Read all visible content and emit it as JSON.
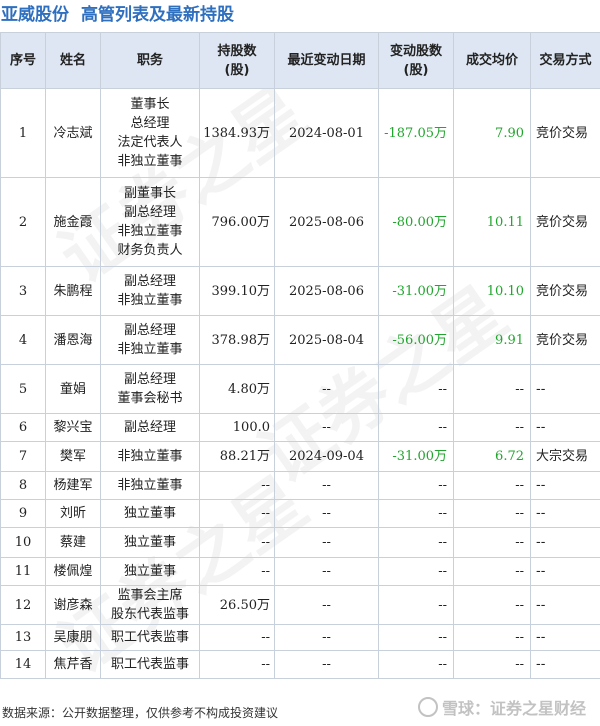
{
  "header": {
    "company": "亚威股份",
    "title": "高管列表及最新持股"
  },
  "table": {
    "columns": [
      "序号",
      "姓名",
      "职务",
      "持股数\n(股)",
      "最近变动日期",
      "变动股数\n(股)",
      "成交均价",
      "交易方式"
    ],
    "rows": [
      {
        "no": "1",
        "name": "冷志斌",
        "roles": [
          "董事长",
          "总经理",
          "法定代表人",
          "非独立董事"
        ],
        "holding": "1384.93万",
        "date": "2024-08-01",
        "change": "-187.05万",
        "price": "7.90",
        "method": "竞价交易"
      },
      {
        "no": "2",
        "name": "施金霞",
        "roles": [
          "副董事长",
          "副总经理",
          "非独立董事",
          "财务负责人"
        ],
        "holding": "796.00万",
        "date": "2025-08-06",
        "change": "-80.00万",
        "price": "10.11",
        "method": "竞价交易"
      },
      {
        "no": "3",
        "name": "朱鹏程",
        "roles": [
          "副总经理",
          "非独立董事"
        ],
        "holding": "399.10万",
        "date": "2025-08-06",
        "change": "-31.00万",
        "price": "10.10",
        "method": "竞价交易"
      },
      {
        "no": "4",
        "name": "潘恩海",
        "roles": [
          "副总经理",
          "非独立董事"
        ],
        "holding": "378.98万",
        "date": "2025-08-04",
        "change": "-56.00万",
        "price": "9.91",
        "method": "竞价交易"
      },
      {
        "no": "5",
        "name": "童娟",
        "roles": [
          "副总经理",
          "董事会秘书"
        ],
        "holding": "4.80万",
        "date": "--",
        "change": "--",
        "price": "--",
        "method": "--"
      },
      {
        "no": "6",
        "name": "黎兴宝",
        "roles": [
          "副总经理"
        ],
        "holding": "100.0",
        "date": "--",
        "change": "--",
        "price": "--",
        "method": "--"
      },
      {
        "no": "7",
        "name": "樊军",
        "roles": [
          "非独立董事"
        ],
        "holding": "88.21万",
        "date": "2024-09-04",
        "change": "-31.00万",
        "price": "6.72",
        "method": "大宗交易"
      },
      {
        "no": "8",
        "name": "杨建军",
        "roles": [
          "非独立董事"
        ],
        "holding": "--",
        "date": "--",
        "change": "--",
        "price": "--",
        "method": "--"
      },
      {
        "no": "9",
        "name": "刘昕",
        "roles": [
          "独立董事"
        ],
        "holding": "--",
        "date": "--",
        "change": "--",
        "price": "--",
        "method": "--"
      },
      {
        "no": "10",
        "name": "蔡建",
        "roles": [
          "独立董事"
        ],
        "holding": "--",
        "date": "--",
        "change": "--",
        "price": "--",
        "method": "--"
      },
      {
        "no": "11",
        "name": "楼佩煌",
        "roles": [
          "独立董事"
        ],
        "holding": "--",
        "date": "--",
        "change": "--",
        "price": "--",
        "method": "--"
      },
      {
        "no": "12",
        "name": "谢彦森",
        "roles": [
          "监事会主席",
          "股东代表监事"
        ],
        "holding": "26.50万",
        "date": "--",
        "change": "--",
        "price": "--",
        "method": "--"
      },
      {
        "no": "13",
        "name": "吴康朋",
        "roles": [
          "职工代表监事"
        ],
        "holding": "--",
        "date": "--",
        "change": "--",
        "price": "--",
        "method": "--"
      },
      {
        "no": "14",
        "name": "焦芹香",
        "roles": [
          "职工代表监事"
        ],
        "holding": "--",
        "date": "--",
        "change": "--",
        "price": "--",
        "method": "--"
      }
    ]
  },
  "footer": {
    "source": "数据来源：公开数据整理，仅供参考不构成投资建议"
  },
  "watermark": {
    "text": "证券之星",
    "brand": "雪球：证券之星财经"
  },
  "colors": {
    "title": "#2f6fbf",
    "header_bg": "#dde6f2",
    "negative": "#22a52e",
    "border": "#c8d0db"
  }
}
